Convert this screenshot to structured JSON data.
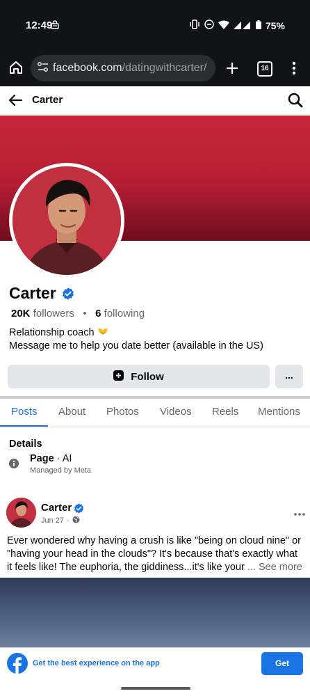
{
  "status": {
    "time": "12:49",
    "battery": "75%"
  },
  "browser": {
    "url_main": "facebook.com",
    "url_path": "/datingwithcarter/",
    "tab_count": "16"
  },
  "header": {
    "title": "Carter"
  },
  "profile": {
    "name": "Carter",
    "followers_count": "20K",
    "followers_label": "followers",
    "following_count": "6",
    "following_label": "following",
    "bio_line1": "Relationship coach",
    "bio_line2": "Message me to help you date better (available in the US)",
    "follow_label": "Follow",
    "more_label": "..."
  },
  "tabs": [
    {
      "label": "Posts"
    },
    {
      "label": "About"
    },
    {
      "label": "Photos"
    },
    {
      "label": "Videos"
    },
    {
      "label": "Reels"
    },
    {
      "label": "Mentions"
    }
  ],
  "details": {
    "heading": "Details",
    "page_type": "Page",
    "page_category": "AI",
    "managed_by": "Managed by Meta"
  },
  "post": {
    "author": "Carter",
    "date": "Jun 27",
    "text": "Ever wondered why having a crush is like \"being on cloud nine\" or \"having your head in the clouds\"? It's because that's exactly what it feels like! The euphoria, the giddiness...it's like your",
    "see_more": "... See more"
  },
  "app_banner": {
    "text": "Get the best experience on the app",
    "button": "Get"
  },
  "colors": {
    "accent": "#1b74e4",
    "cover": "#c8273a",
    "statusbar": "#121316"
  }
}
